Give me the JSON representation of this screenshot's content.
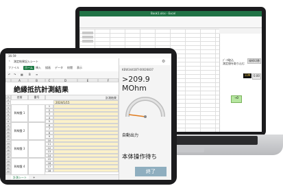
{
  "laptop": {
    "title": "Book1.xlsx - Excel",
    "panel": {
      "label_top": "ﾃﾞｰﾀ取込",
      "label_sub": "測定値を取り込む",
      "button_top": "接続切替",
      "display_value": "11M",
      "display_value2": "0.00",
      "green_button": "→0",
      "orange_button": "終了"
    }
  },
  "tablet": {
    "status_time": "16:59",
    "app_title": "測定結果記入シート",
    "tabs": [
      "ファイル",
      "ホーム",
      "挿入",
      "描画",
      "データ",
      "校閲",
      "表示"
    ],
    "active_tab_index": 1,
    "sheet": {
      "title": "絶縁抵抗計測結果",
      "col_headers": [
        "A",
        "B",
        "C",
        "D",
        "E",
        "F"
      ],
      "header_row": {
        "name": "名前",
        "number": "番号",
        "date_label": "2024/1/15"
      },
      "result_header": "計測結果",
      "unit_header": "1",
      "row_numbers": [
        "1",
        "2",
        "3",
        "4",
        "5",
        "6",
        "7",
        "8",
        "9",
        "10",
        "11",
        "12",
        "13",
        "14",
        "15",
        "16",
        "17",
        "18",
        "19",
        "20",
        "21",
        "22",
        "23",
        "24",
        "25"
      ],
      "groups": [
        {
          "name": "幹線盤 1"
        },
        {
          "name": "幹線盤 2"
        },
        {
          "name": "幹線盤 3"
        },
        {
          "name": "幹線盤 4"
        }
      ],
      "sheet_tab": "計測シート"
    },
    "meter": {
      "device_id": "KEW3441BT-00026837",
      "reading": ">209.9 MOhm",
      "auto_output": "自動出力",
      "status": "本体操作待ち",
      "end_button": "終了",
      "gauge_value_fraction": 0.04
    }
  }
}
